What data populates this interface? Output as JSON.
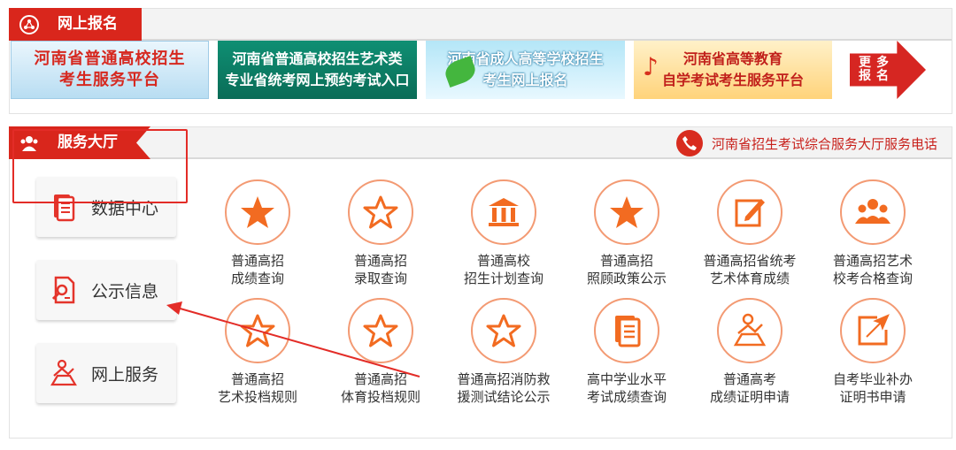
{
  "registration": {
    "title": "网上报名",
    "banners": [
      {
        "line1": "河南省普通高校招生",
        "line2": "考生服务平台"
      },
      {
        "line1": "河南省普通高校招生艺术类",
        "line2": "专业省统考网上预约考试入口"
      },
      {
        "line1": "河南省成人高等学校招生",
        "line2": "考生网上报名"
      },
      {
        "line1": "河南省高等教育",
        "line2": "自学考试考生服务平台"
      }
    ],
    "more_label": "更多报名"
  },
  "service": {
    "title": "服务大厅",
    "hotline": "河南省招生考试综合服务大厅服务电话",
    "side_items": [
      {
        "label": "数据中心",
        "icon": "document-stack-icon"
      },
      {
        "label": "公示信息",
        "icon": "document-search-icon"
      },
      {
        "label": "网上服务",
        "icon": "person-desk-icon"
      }
    ],
    "grid": [
      {
        "label": "普通高招\n成绩查询",
        "icon": "star-filled-icon"
      },
      {
        "label": "普通高招\n录取查询",
        "icon": "star-outline-icon"
      },
      {
        "label": "普通高校\n招生计划查询",
        "icon": "building-icon"
      },
      {
        "label": "普通高招\n照顾政策公示",
        "icon": "star-filled-icon"
      },
      {
        "label": "普通高招省统考\n艺术体育成绩",
        "icon": "edit-note-icon"
      },
      {
        "label": "普通高招艺术\n校考合格查询",
        "icon": "people-group-icon"
      },
      {
        "label": "普通高招\n艺术投档规则",
        "icon": "star-outline-icon"
      },
      {
        "label": "普通高招\n体育投档规则",
        "icon": "star-outline-icon"
      },
      {
        "label": "普通高招消防救\n援测试结论公示",
        "icon": "star-outline-icon"
      },
      {
        "label": "高中学业水平\n考试成绩查询",
        "icon": "document-stack-icon"
      },
      {
        "label": "普通高考\n成绩证明申请",
        "icon": "person-desk-icon"
      },
      {
        "label": "自考毕业补办\n证明书申请",
        "icon": "export-arrow-icon"
      }
    ]
  },
  "colors": {
    "brand_red": "#d9261c",
    "icon_orange": "#f26b21",
    "circle_border": "#f39a73"
  }
}
